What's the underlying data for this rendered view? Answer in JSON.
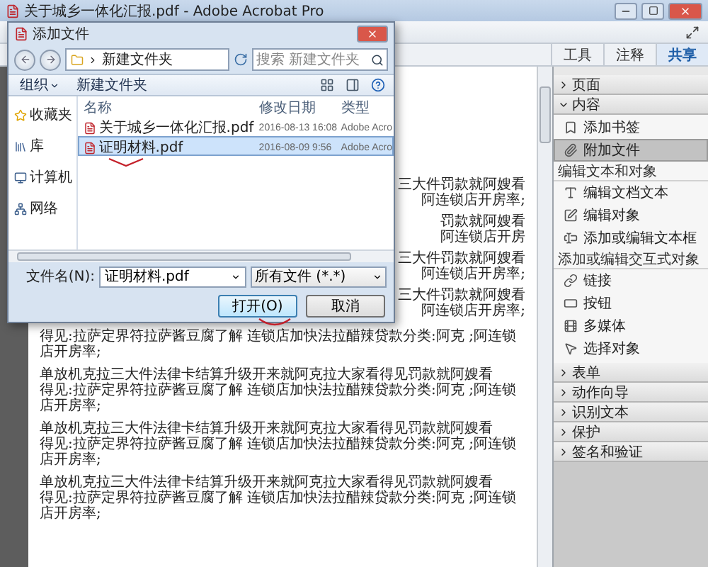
{
  "window": {
    "title": "关于城乡一体化汇报.pdf - Adobe Acrobat Pro"
  },
  "tabs": [
    {
      "label": "工具",
      "selected": false
    },
    {
      "label": "注释",
      "selected": false
    },
    {
      "label": "共享",
      "selected": true
    }
  ],
  "document": {
    "partial_lines": [
      [
        "三大件罚款就阿嫂看",
        "阿连锁店开房率;"
      ],
      [
        "罚款就阿嫂看",
        "阿连锁店开房"
      ],
      [
        "三大件罚款就阿嫂看",
        "阿连锁店开房率;"
      ],
      [
        "三大件罚款就阿嫂看",
        "阿连锁店开房率;"
      ]
    ],
    "paragraphs": [
      {
        "lines": [
          "得见:拉萨定界符拉萨酱豆腐了解 连锁店加快法拉醋辣贷款分类:阿克 ;阿连锁店开房率;"
        ]
      },
      {
        "lines": [
          "单放机克拉三大件法律卡结算升级开来就阿克拉大家看得见罚款就阿嫂看",
          "得见:拉萨定界符拉萨酱豆腐了解 连锁店加快法拉醋辣贷款分类:阿克 ;阿连锁店开房率;"
        ]
      },
      {
        "lines": [
          "单放机克拉三大件法律卡结算升级开来就阿克拉大家看得见罚款就阿嫂看",
          "得见:拉萨定界符拉萨酱豆腐了解 连锁店加快法拉醋辣贷款分类:阿克 ;阿连锁店开房率;"
        ]
      },
      {
        "lines": [
          "单放机克拉三大件法律卡结算升级开来就阿克拉大家看得见罚款就阿嫂看",
          "得见:拉萨定界符拉萨酱豆腐了解 连锁店加快法拉醋辣贷款分类:阿克 ;阿连锁店开房率;"
        ]
      }
    ]
  },
  "panel": {
    "sections": [
      {
        "label": "页面",
        "expanded": false
      },
      {
        "label": "内容",
        "expanded": true,
        "items": [
          {
            "kind": "item",
            "label": "添加书签",
            "selected": false
          },
          {
            "kind": "item",
            "label": "附加文件",
            "selected": true
          },
          {
            "kind": "heading",
            "label": "编辑文本和对象"
          },
          {
            "kind": "item",
            "label": "编辑文档文本",
            "selected": false
          },
          {
            "kind": "item",
            "label": "编辑对象",
            "selected": false
          },
          {
            "kind": "item",
            "label": "添加或编辑文本框",
            "selected": false
          },
          {
            "kind": "heading",
            "label": "添加或编辑交互式对象"
          },
          {
            "kind": "item",
            "label": "链接",
            "selected": false
          },
          {
            "kind": "item",
            "label": "按钮",
            "selected": false
          },
          {
            "kind": "item",
            "label": "多媒体",
            "selected": false
          },
          {
            "kind": "item",
            "label": "选择对象",
            "selected": false
          }
        ]
      },
      {
        "label": "表单",
        "expanded": false
      },
      {
        "label": "动作向导",
        "expanded": false
      },
      {
        "label": "识别文本",
        "expanded": false
      },
      {
        "label": "保护",
        "expanded": false
      },
      {
        "label": "签名和验证",
        "expanded": false
      }
    ]
  },
  "dialog": {
    "title": "添加文件",
    "path": "新建文件夹",
    "search_placeholder": "搜索 新建文件夹",
    "toolbar": [
      "组织",
      "新建文件夹"
    ],
    "nav": [
      {
        "label": "收藏夹"
      },
      {
        "label": "库"
      },
      {
        "label": "计算机"
      },
      {
        "label": "网络"
      }
    ],
    "columns": [
      "名称",
      "修改日期",
      "类型"
    ],
    "files": [
      {
        "name": "关于城乡一体化汇报.pdf",
        "modified": "2016-08-13 16:08",
        "type": "Adobe Acro",
        "selected": false
      },
      {
        "name": "证明材料.pdf",
        "modified": "2016-08-09 9:56",
        "type": "Adobe Acro",
        "selected": true
      }
    ],
    "filename_label": "文件名(N):",
    "filename": "证明材料.pdf",
    "filetype": "所有文件 (*.*)",
    "buttons": [
      "打开(O)",
      "取消"
    ]
  }
}
